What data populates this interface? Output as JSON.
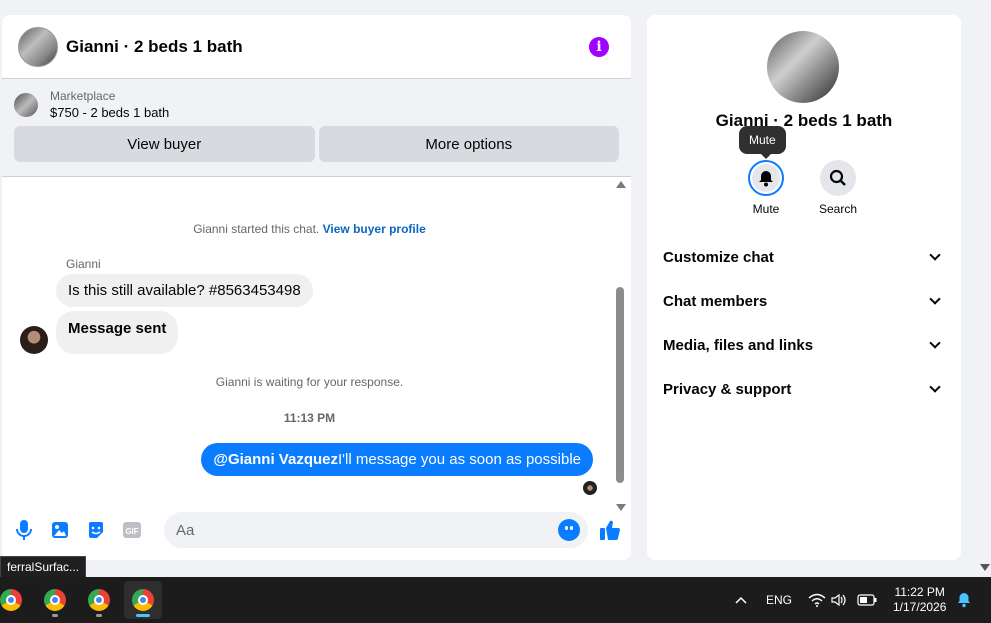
{
  "chat": {
    "title": "Gianni · 2 beds 1 bath",
    "marketplace_label": "Marketplace",
    "listing": "$750 - 2 beds 1 bath",
    "view_buyer": "View buyer",
    "more_options": "More options",
    "started_text": "Gianni started this chat.",
    "view_profile": "View buyer profile",
    "sender": "Gianni",
    "msg1": "Is this still available? #8563453498",
    "msg2": "Message sent",
    "waiting": "Gianni is waiting for your response.",
    "time": "11:13 PM",
    "out_mention": "@Gianni Vazquez",
    "out_text": "I'll message you as soon as possible",
    "input_placeholder": "Aa"
  },
  "info": {
    "title": "Gianni · 2 beds 1 bath",
    "tooltip": "Mute",
    "mute": "Mute",
    "search": "Search",
    "items": [
      "Customize chat",
      "Chat members",
      "Media, files and links",
      "Privacy & support"
    ]
  },
  "taskbar": {
    "hover_label": "ferralSurfac...",
    "lang": "ENG",
    "time": "11:22 PM",
    "date": "1/17/2026"
  },
  "colors": {
    "accent": "#0a7cff",
    "info": "#a200ff",
    "link": "#0a66c2"
  }
}
